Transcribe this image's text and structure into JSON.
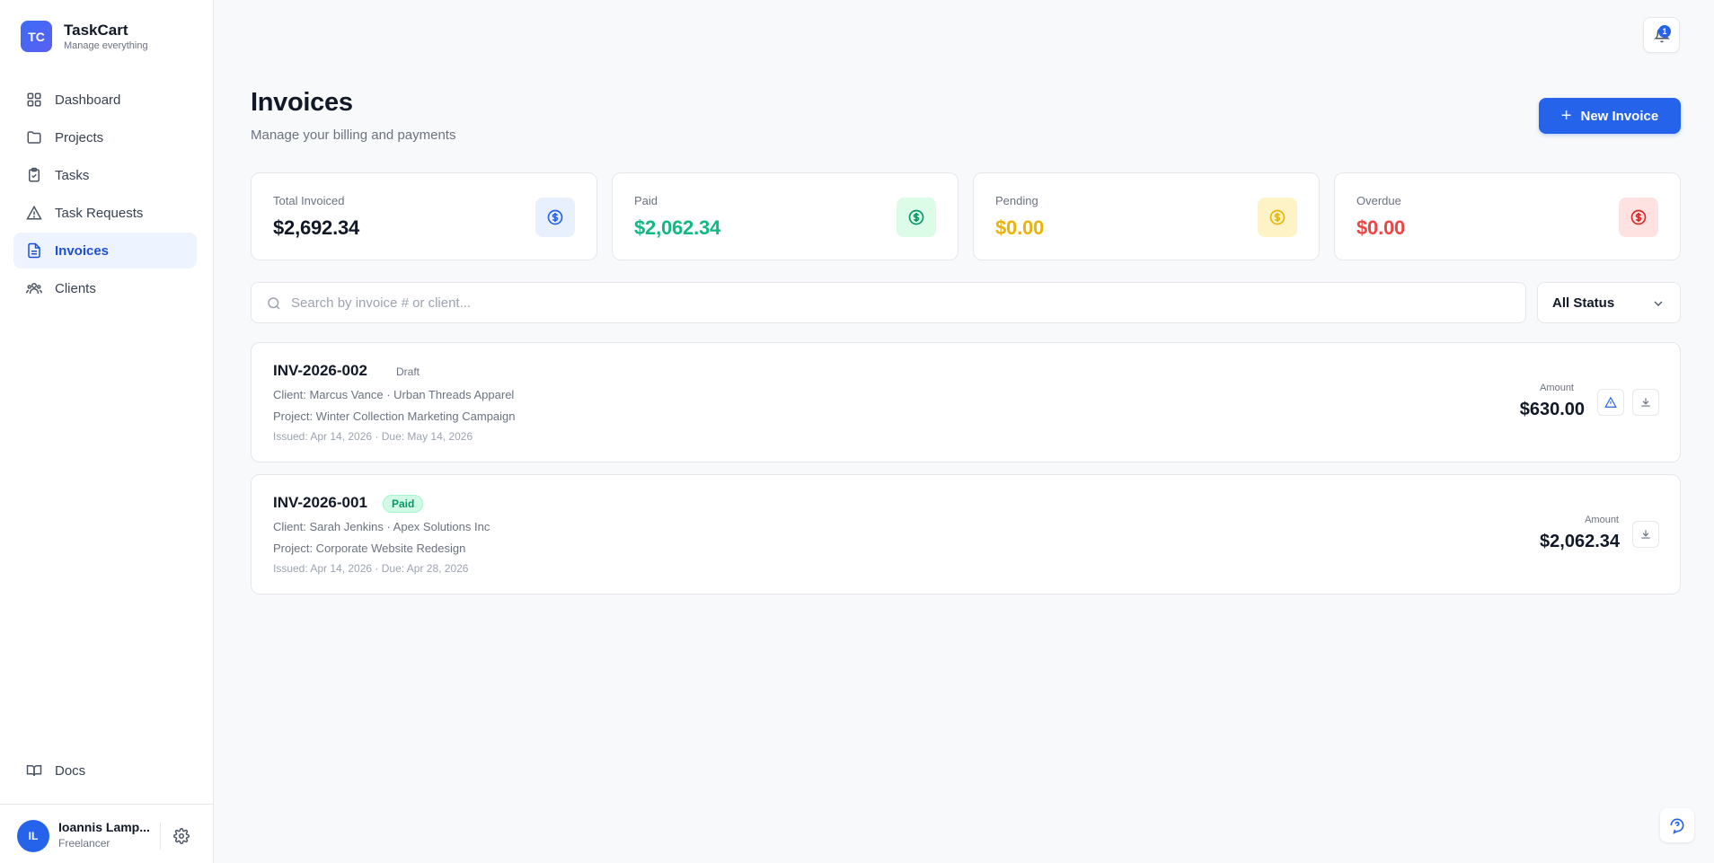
{
  "brand": {
    "logo": "TC",
    "name": "TaskCart",
    "tagline": "Manage everything"
  },
  "nav": {
    "items": [
      {
        "label": "Dashboard",
        "icon": "grid-icon"
      },
      {
        "label": "Projects",
        "icon": "folder-icon"
      },
      {
        "label": "Tasks",
        "icon": "clipboard-check-icon"
      },
      {
        "label": "Task Requests",
        "icon": "alert-triangle-icon"
      },
      {
        "label": "Invoices",
        "icon": "file-text-icon",
        "active": true
      },
      {
        "label": "Clients",
        "icon": "users-icon"
      }
    ],
    "docs": "Docs"
  },
  "user": {
    "initials": "IL",
    "name": "Ioannis Lamp...",
    "role": "Freelancer"
  },
  "header": {
    "notification_count": "1"
  },
  "page": {
    "title": "Invoices",
    "subtitle": "Manage your billing and payments",
    "new_button": "New Invoice"
  },
  "stats": [
    {
      "label": "Total Invoiced",
      "value": "$2,692.34",
      "color": "#111827",
      "icon_color": "#2563eb",
      "icon_bg": "#e8f0fe"
    },
    {
      "label": "Paid",
      "value": "$2,062.34",
      "color": "#10b981",
      "icon_color": "#059669",
      "icon_bg": "#dcfce7"
    },
    {
      "label": "Pending",
      "value": "$0.00",
      "color": "#eab308",
      "icon_color": "#eab308",
      "icon_bg": "#fef3c7"
    },
    {
      "label": "Overdue",
      "value": "$0.00",
      "color": "#ef4444",
      "icon_color": "#dc2626",
      "icon_bg": "#fee2e2"
    }
  ],
  "search": {
    "placeholder": "Search by invoice # or client...",
    "value": ""
  },
  "status_filter": {
    "selected": "All Status"
  },
  "invoices": [
    {
      "number": "INV-2026-002",
      "status": "Draft",
      "client": "Client: Marcus Vance · Urban Threads Apparel",
      "project": "Project: Winter Collection Marketing Campaign",
      "dates": "Issued: Apr 14, 2026 · Due: May 14, 2026",
      "amount_label": "Amount",
      "amount": "$630.00"
    },
    {
      "number": "INV-2026-001",
      "status": "Paid",
      "client": "Client: Sarah Jenkins · Apex Solutions Inc",
      "project": "Project: Corporate Website Redesign",
      "dates": "Issued: Apr 14, 2026 · Due: Apr 28, 2026",
      "amount_label": "Amount",
      "amount": "$2,062.34"
    }
  ]
}
